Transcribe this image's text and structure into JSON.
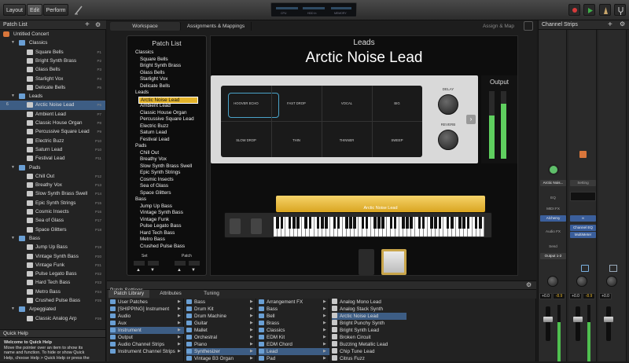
{
  "toolbar": {
    "layout_label": "Layout",
    "edit_label": "Edit",
    "perform_label": "Perform",
    "lcd_left": "CPU",
    "lcd_mid": "HDD In",
    "lcd_right": "MEMORY"
  },
  "patch_list": {
    "title": "Patch List",
    "concert": "Untitled Concert",
    "rows": [
      {
        "label": "Classics",
        "type": "folder",
        "key": ""
      },
      {
        "label": "Square Bells",
        "type": "patch",
        "key": "P1"
      },
      {
        "label": "Bright Synth Brass",
        "type": "patch",
        "key": "P2"
      },
      {
        "label": "Glass Bells",
        "type": "patch",
        "key": "P3"
      },
      {
        "label": "Starlight Vox",
        "type": "patch",
        "key": "P4"
      },
      {
        "label": "Delicate Bells",
        "type": "patch",
        "key": "P5"
      },
      {
        "label": "Leads",
        "type": "folder",
        "key": ""
      },
      {
        "label": "Arctic Noise Lead",
        "type": "patch",
        "key": "P6",
        "num": "6"
      },
      {
        "label": "Ambient Lead",
        "type": "patch",
        "key": "P7"
      },
      {
        "label": "Classic House Organ",
        "type": "patch",
        "key": "P8"
      },
      {
        "label": "Percussive Square Lead",
        "type": "patch",
        "key": "P9"
      },
      {
        "label": "Electric Buzz",
        "type": "patch",
        "key": "P10"
      },
      {
        "label": "Saturn Lead",
        "type": "patch",
        "key": "P10"
      },
      {
        "label": "Festival Lead",
        "type": "patch",
        "key": "P11"
      },
      {
        "label": "Pads",
        "type": "folder",
        "key": ""
      },
      {
        "label": "Chill Out",
        "type": "patch",
        "key": "P12"
      },
      {
        "label": "Breathy Vox",
        "type": "patch",
        "key": "P13"
      },
      {
        "label": "Slow Synth Brass Swell",
        "type": "patch",
        "key": "P14"
      },
      {
        "label": "Epic Synth Strings",
        "type": "patch",
        "key": "P15"
      },
      {
        "label": "Cosmic Insects",
        "type": "patch",
        "key": "P16"
      },
      {
        "label": "Sea of Glass",
        "type": "patch",
        "key": "P17"
      },
      {
        "label": "Space Glitters",
        "type": "patch",
        "key": "P18"
      },
      {
        "label": "Bass",
        "type": "folder",
        "key": ""
      },
      {
        "label": "Jump Up Bass",
        "type": "patch",
        "key": "P19"
      },
      {
        "label": "Vintage Synth Bass",
        "type": "patch",
        "key": "P20"
      },
      {
        "label": "Vintage Funk",
        "type": "patch",
        "key": "P21"
      },
      {
        "label": "Pulse Legato Bass",
        "type": "patch",
        "key": "P22"
      },
      {
        "label": "Hard Tech Bass",
        "type": "patch",
        "key": "P23"
      },
      {
        "label": "Metro Bass",
        "type": "patch",
        "key": "P24"
      },
      {
        "label": "Crushed Pulse Bass",
        "type": "patch",
        "key": "P25"
      },
      {
        "label": "Arpeggiated",
        "type": "folder",
        "key": ""
      },
      {
        "label": "Classic Analog Arp",
        "type": "patch",
        "key": "P26"
      }
    ]
  },
  "quick_help": {
    "title": "Quick Help",
    "heading": "Welcome to Quick Help",
    "lines": [
      "Move the pointer over an item to show its",
      "name and function. To hide or show Quick",
      "Help, choose Help > Quick Help or press the"
    ]
  },
  "tabs": {
    "workspace": "Workspace",
    "assign": "Assignments & Mappings",
    "assign_map": "Assign & Map"
  },
  "screen": {
    "panel_title": "Patch List",
    "categories": [
      {
        "name": "Classics",
        "items": [
          "Square Bells",
          "Bright Synth Brass",
          "Glass Bells",
          "Starlight Vox",
          "Delicate Bells"
        ]
      },
      {
        "name": "Leads",
        "items": [
          "Arctic Noise Lead",
          "Ambient Lead",
          "Classic House Organ",
          "Percussive Square Lead",
          "Electric Buzz",
          "Saturn Lead",
          "Festival Lead"
        ]
      },
      {
        "name": "Pads",
        "items": [
          "Chill Out",
          "Breathy Vox",
          "Slow Synth Brass Swell",
          "Epic Synth Strings",
          "Cosmic Insects",
          "Sea of Glass",
          "Space Glitters"
        ]
      },
      {
        "name": "Bass",
        "items": [
          "Jump Up Bass",
          "Vintage Synth Bass",
          "Vintage Funk",
          "Pulse Legato Bass",
          "Hard Tech Bass",
          "Metro Bass",
          "Crushed Pulse Bass"
        ]
      }
    ],
    "set_label": "Set",
    "patch_label": "Patch",
    "category": "Leads",
    "patch_name": "Arctic Noise Lead",
    "output_label": "Output",
    "keyboard_label": "Arctic Noise Lead",
    "cells": [
      "HOOVER ECHO",
      "FAST DROP",
      "VOCAL",
      "BIG",
      "SLOW DROP",
      "THIN",
      "THINNER",
      "SWEEP"
    ],
    "delay_label": "DELAY",
    "reverb_label": "REVERB"
  },
  "patch_settings": {
    "title": "Patch Settings",
    "tabs": [
      "Patch Library",
      "Attributes",
      "Tuning"
    ],
    "col1": [
      "User Patches",
      "[SHIPPING] Instrument",
      "Audio",
      "Aux",
      "Instrument",
      "Output",
      "Audio Channel Strips",
      "Instrument Channel Strips"
    ],
    "col2": [
      "Bass",
      "Drum Kit",
      "Drum Machine",
      "Guitar",
      "Mallet",
      "Orchestral",
      "Piano",
      "Synthesizer",
      "Vintage B3 Organ"
    ],
    "col3": [
      "Arrangement FX",
      "Bass",
      "Bell",
      "Brass",
      "Classics",
      "EDM Kit",
      "EDM Chord",
      "Lead",
      "Pad"
    ],
    "col4": [
      "Analog Mono Lead",
      "Analog Stack Synth",
      "Arctic Noise Lead",
      "Bright Punchy Synth",
      "Bright Synth Lead",
      "Broken Circuit",
      "Buzzing Metallic Lead",
      "Chip Tune Lead",
      "Citrus Fuzz"
    ]
  },
  "channel_strips": {
    "title": "Channel Strips",
    "strip1_name": "Arctic Nois...",
    "strip2_name": "Setting",
    "eq_label": "EQ",
    "midifx_label": "MIDI FX",
    "plugin1": "Alchemy",
    "audiofx_label": "Audio FX",
    "plugin2": "Channel EQ",
    "plugin3": "MultiMeter",
    "send_label": "Send",
    "output_label": "Output 1-2",
    "vol_a1": "+0.0",
    "vol_b1": "-8.9",
    "vol_a2": "+0.0",
    "vol_b2": "-8.9",
    "vol_a3": "+0.0"
  },
  "colors": {
    "accent": "#3d5d84",
    "selected_patch": "#e3b32a",
    "folder": "#6a9fd4",
    "record": "#d63b3b",
    "play": "#3fae49"
  }
}
